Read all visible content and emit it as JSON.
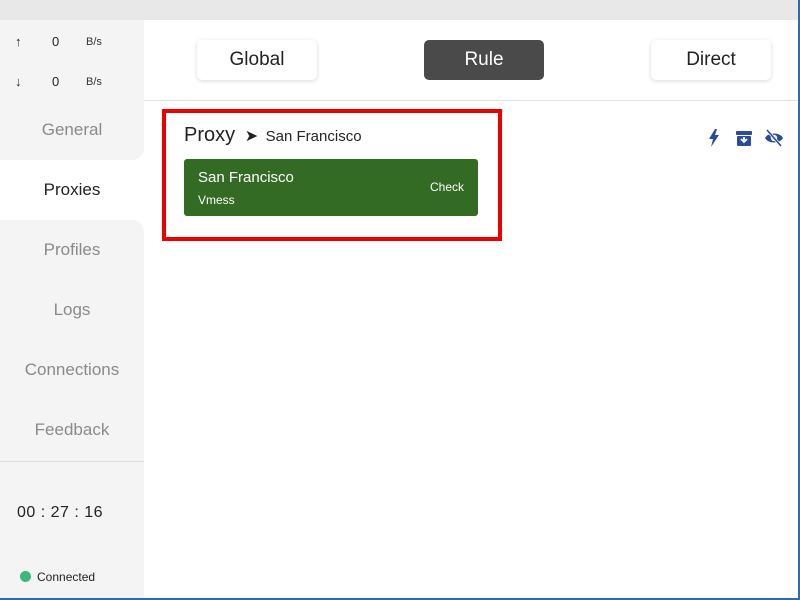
{
  "traffic": {
    "upload_arrow": "↑",
    "upload_value": "0",
    "upload_unit": "B/s",
    "download_arrow": "↓",
    "download_value": "0",
    "download_unit": "B/s"
  },
  "nav": {
    "items": [
      {
        "label": "General"
      },
      {
        "label": "Proxies"
      },
      {
        "label": "Profiles"
      },
      {
        "label": "Logs"
      },
      {
        "label": "Connections"
      },
      {
        "label": "Feedback"
      }
    ],
    "active": "Proxies"
  },
  "timer": "00 : 27 : 16",
  "status": {
    "label": "Connected",
    "color": "#3cb878"
  },
  "modes": {
    "global": "Global",
    "rule": "Rule",
    "direct": "Direct",
    "active": "Rule"
  },
  "group": {
    "name": "Proxy",
    "separator": "➤",
    "selected": "San Francisco"
  },
  "proxy": {
    "name": "San Francisco",
    "type": "Vmess",
    "check_label": "Check",
    "color": "#336a24"
  },
  "toolbar": {
    "icons": [
      "lightning-icon",
      "archive-icon",
      "eye-slash-icon"
    ],
    "icon_color": "#2a4a9a"
  },
  "highlight_color": "#ee0000"
}
